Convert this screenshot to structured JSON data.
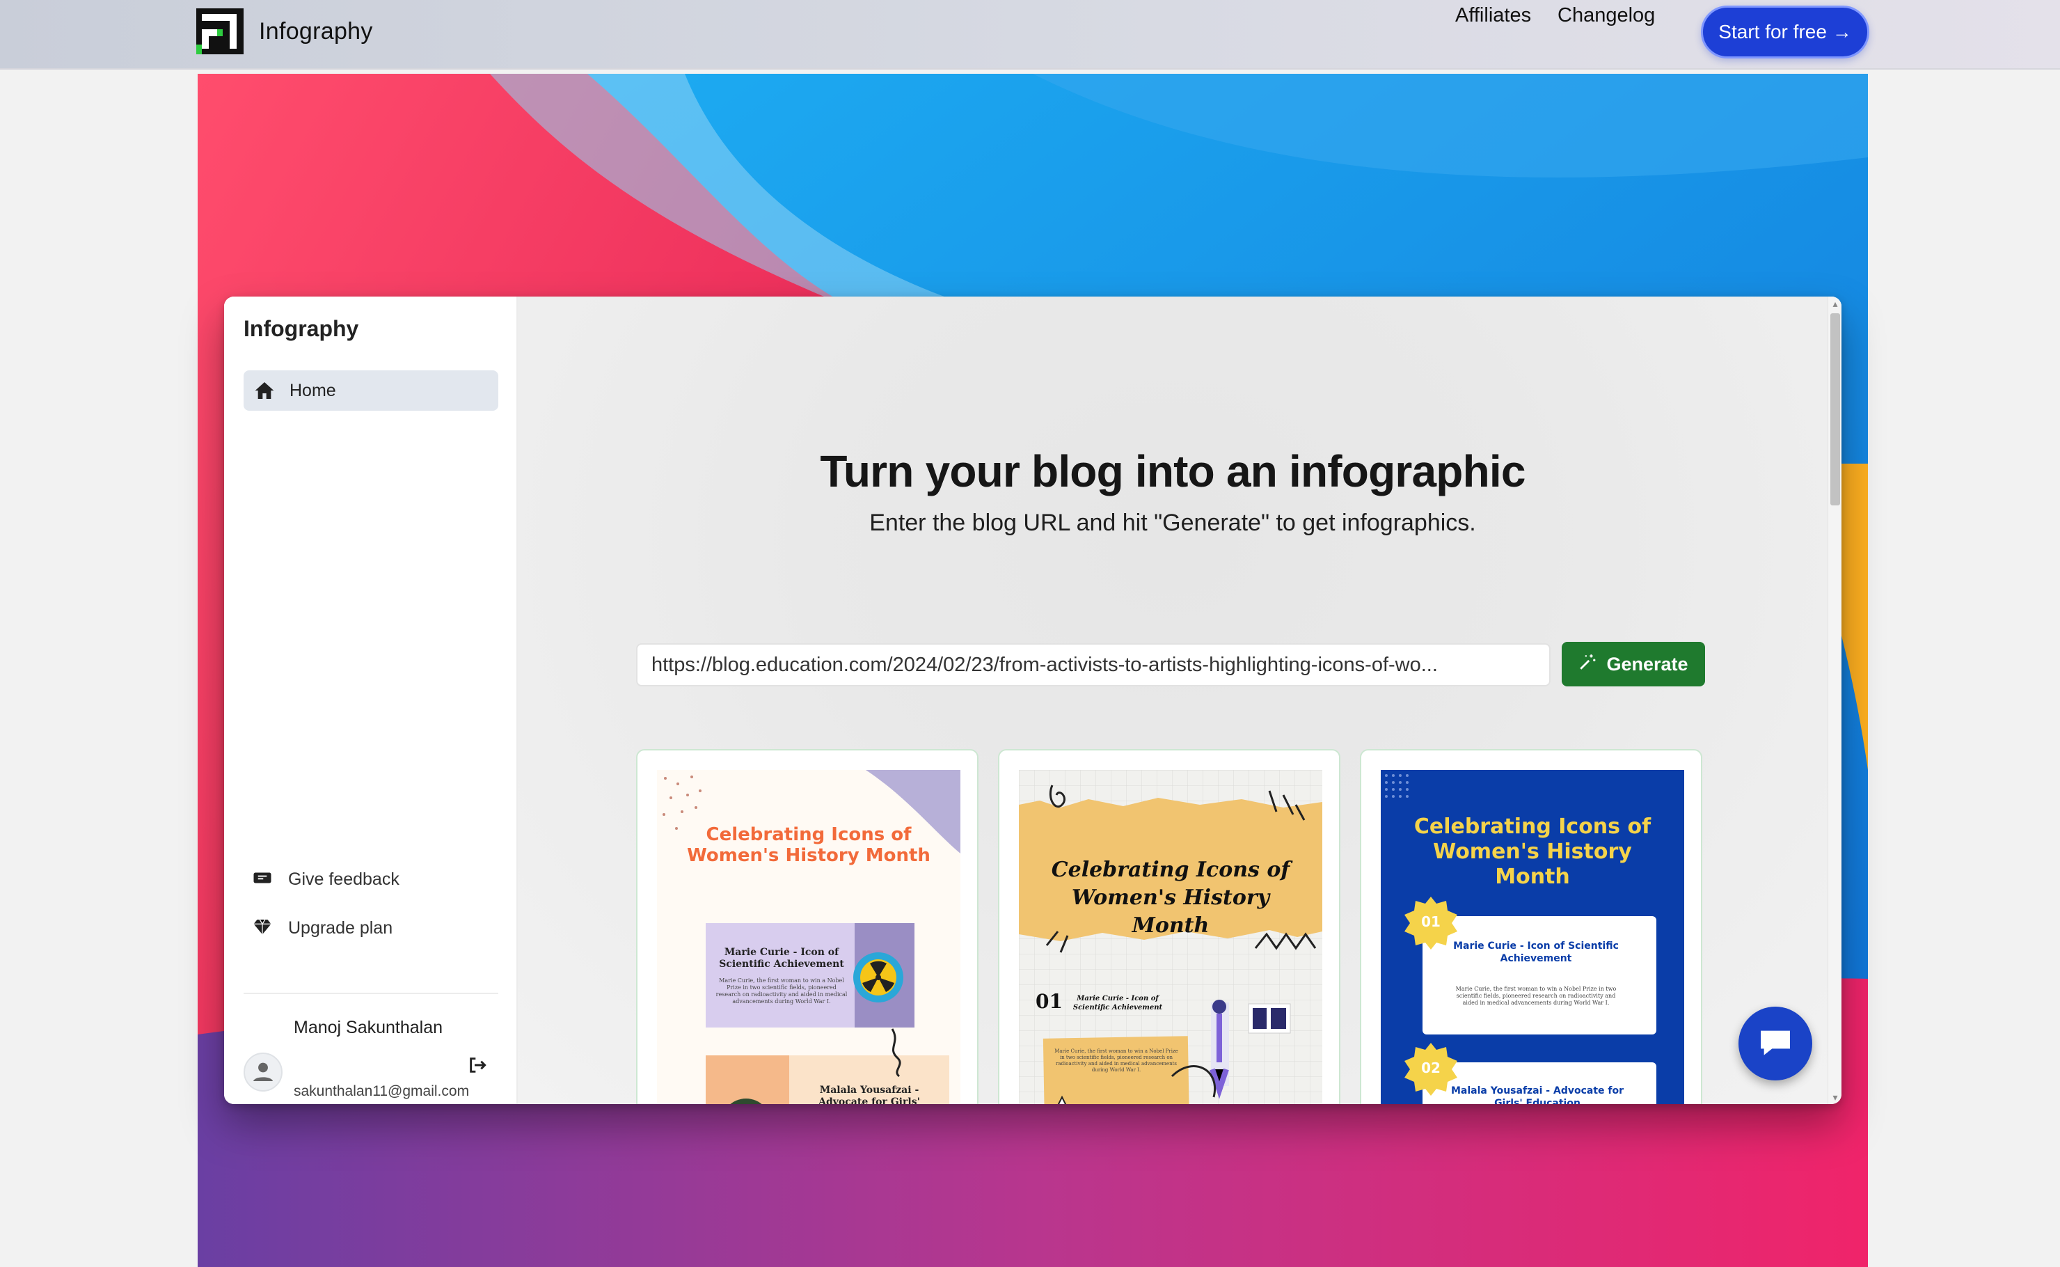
{
  "nav": {
    "brand": "Infography",
    "links": [
      "Affiliates",
      "Changelog"
    ],
    "cta": "Start for free →"
  },
  "app": {
    "sidebar": {
      "title": "Infography",
      "items": [
        {
          "label": "Home",
          "icon": "home-icon",
          "active": true
        }
      ],
      "bottom_items": [
        {
          "label": "Give feedback",
          "icon": "feedback-icon"
        },
        {
          "label": "Upgrade plan",
          "icon": "gem-icon"
        }
      ],
      "user": {
        "name": "Manoj Sakunthalan",
        "email": "sakunthalan11@gmail.com"
      }
    },
    "main": {
      "headline": "Turn your blog into an infographic",
      "subline": "Enter the blog URL and hit \"Generate\" to get infographics.",
      "url_value": "https://blog.education.com/2024/02/23/from-activists-to-artists-highlighting-icons-of-wo...",
      "generate_label": "Generate"
    },
    "cards": [
      {
        "title": "Celebrating Icons of Women's History Month",
        "items": [
          "Marie Curie - Icon of Scientific Achievement",
          "Malala Yousafzai - Advocate for Girls' Education"
        ],
        "body": "Marie Curie, the first woman to win a Nobel Prize in two scientific fields, pioneered research on radioactivity and aided in medical advancements during World War I."
      },
      {
        "title": "Celebrating Icons of Women's History Month",
        "number": "01",
        "items": [
          "Marie Curie - Icon of Scientific Achievement"
        ],
        "body": "Marie Curie, the first woman to win a Nobel Prize in two scientific fields, pioneered research on radioactivity and aided in medical advancements during World War I."
      },
      {
        "title": "Celebrating Icons of Women's History Month",
        "numbers": [
          "01",
          "02"
        ],
        "items": [
          "Marie Curie - Icon of Scientific Achievement",
          "Malala Yousafzai - Advocate for Girls' Education"
        ],
        "body": "Marie Curie, the first woman to win a Nobel Prize in two scientific fields, pioneered research on radioactivity and aided in medical advancements during World War I."
      }
    ]
  },
  "colors": {
    "cta": "#1d3fd6",
    "generate": "#1f7a2e",
    "chat": "#1a43c7",
    "card1_title": "#f26a3a",
    "card3_bg": "#0a3da8",
    "card3_title": "#f5d34a"
  }
}
